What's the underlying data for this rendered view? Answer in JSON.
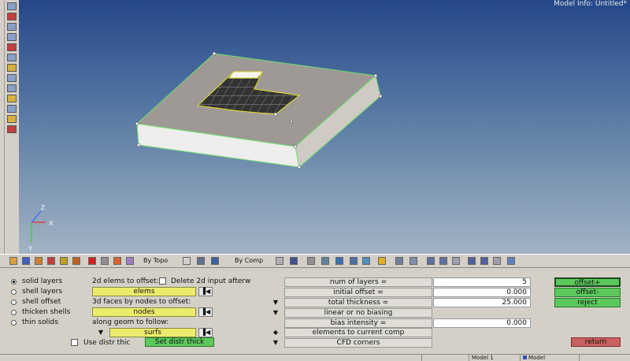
{
  "viewport": {
    "model_info": "Model Info: Untitled*",
    "axis_x": "X",
    "axis_y": "Y",
    "axis_z": "Z"
  },
  "toolbar": {
    "by_topo": "By Topo",
    "by_comp": "By Comp"
  },
  "radios": [
    {
      "label": "solid layers",
      "selected": true
    },
    {
      "label": "shell layers",
      "selected": false
    },
    {
      "label": "shell offset",
      "selected": false
    },
    {
      "label": "thicken shells",
      "selected": false
    },
    {
      "label": "thin solids",
      "selected": false
    }
  ],
  "middle": {
    "offset_label": "2d elems to offset:",
    "delete_label": "Delete 2d input afterw",
    "elems": "elems",
    "faces_label": "3d faces by nodes to offset:",
    "nodes": "nodes",
    "geom_label": "along geom to follow:",
    "surfs": "surfs",
    "use_distr": "Use distr thic",
    "set_distr": "Set distr thick"
  },
  "params": {
    "num_layers_label": "num of layers  =",
    "num_layers": "5",
    "initial_offset_label": "initial offset =",
    "initial_offset": "0.000",
    "total_thickness_label": "total thickness =",
    "total_thickness": "25.000",
    "biasing": "linear or no biasing",
    "bias_label": "bias intensity =",
    "bias": "0.000",
    "to_comp": "elements to current comp",
    "cfd": "CFD corners"
  },
  "actions": {
    "offset_plus": "offset+",
    "offset_minus": "offset-",
    "reject": "reject",
    "return": "return"
  },
  "statusbar": {
    "model1": "Model 1",
    "model": "Model"
  },
  "colors": {
    "yellow": "#ecec6c",
    "green": "#5cc85c",
    "red": "#c86060"
  }
}
